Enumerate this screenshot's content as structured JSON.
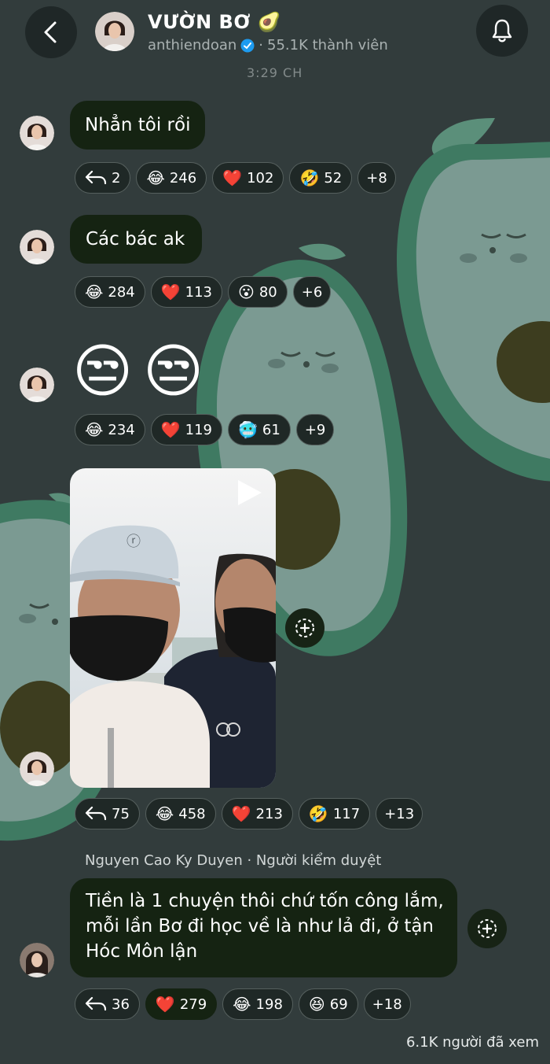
{
  "header": {
    "title": "VƯỜN BƠ",
    "title_emoji": "🥑",
    "username": "anthiendoan",
    "members": "55.1K thành viên",
    "time": "3:29 CH"
  },
  "messages": [
    {
      "text": "Nhẳn tôi rồi",
      "reactions": [
        {
          "emoji": "↩",
          "count": "2"
        },
        {
          "emoji": "😂",
          "count": "246"
        },
        {
          "emoji": "❤️",
          "count": "102"
        },
        {
          "emoji": "🤣",
          "count": "52"
        },
        {
          "emoji": "",
          "count": "+8"
        }
      ]
    },
    {
      "text": "Các bác ak",
      "reactions": [
        {
          "emoji": "😂",
          "count": "284"
        },
        {
          "emoji": "❤️",
          "count": "113"
        },
        {
          "emoji": "😮",
          "count": "80"
        },
        {
          "emoji": "",
          "count": "+6"
        }
      ]
    },
    {
      "emojis": [
        "😒",
        "😒"
      ],
      "reactions": [
        {
          "emoji": "😂",
          "count": "234"
        },
        {
          "emoji": "❤️",
          "count": "119"
        },
        {
          "emoji": "🥶",
          "count": "61"
        },
        {
          "emoji": "",
          "count": "+9"
        }
      ]
    },
    {
      "type": "video",
      "reactions": [
        {
          "emoji": "↩",
          "count": "75"
        },
        {
          "emoji": "😂",
          "count": "458"
        },
        {
          "emoji": "❤️",
          "count": "213"
        },
        {
          "emoji": "🤣",
          "count": "117"
        },
        {
          "emoji": "",
          "count": "+13"
        }
      ]
    },
    {
      "sender": "Nguyen Cao Ky Duyen · Người kiểm duyệt",
      "lines": [
        "Tiền là 1 chuyện thôi chứ tốn công lắm,",
        "mỗi lần Bơ đi học về là như lả đi, ở tận",
        "Hóc Môn lận"
      ],
      "reactions": [
        {
          "emoji": "↩",
          "count": "36"
        },
        {
          "emoji": "❤️",
          "count": "279"
        },
        {
          "emoji": "😂",
          "count": "198"
        },
        {
          "emoji": "😆",
          "count": "69"
        },
        {
          "emoji": "",
          "count": "+18"
        }
      ]
    }
  ],
  "footer": {
    "views": "6.1K người đã xem"
  }
}
